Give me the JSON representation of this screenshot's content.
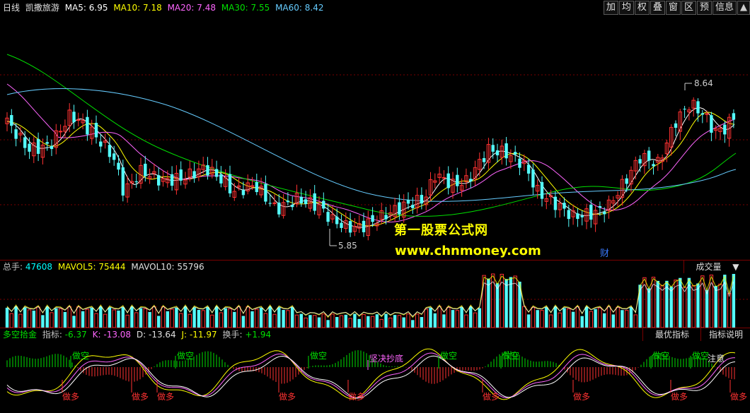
{
  "header": {
    "period": "日线",
    "stock_name": "凯撒旅游",
    "ma5": {
      "label": "MA5:",
      "value": "6.95",
      "color": "#ffffff"
    },
    "ma10": {
      "label": "MA10:",
      "value": "7.18",
      "color": "#ffff00"
    },
    "ma20": {
      "label": "MA20:",
      "value": "7.48",
      "color": "#ff66ff"
    },
    "ma30": {
      "label": "MA30:",
      "value": "7.55",
      "color": "#00e000"
    },
    "ma60": {
      "label": "MA60:",
      "value": "8.42",
      "color": "#66ccff"
    },
    "buttons": [
      "加",
      "均",
      "权",
      "叠",
      "窗",
      "区",
      "预",
      "信息"
    ],
    "expand_arrow": "▲"
  },
  "price_chart": {
    "high_label": "8.64",
    "low_label": "5.85",
    "finance_marker": "财"
  },
  "watermark": {
    "line1": "第一股票公式网",
    "line2": "www.chnmoney.com"
  },
  "volume_panel": {
    "total_label": "总手:",
    "total_value": "47608",
    "mavol5_label": "MAVOL5:",
    "mavol5_value": "75444",
    "mavol10_label": "MAVOL10:",
    "mavol10_value": "55796",
    "selector": "成交量",
    "selector_arrow": "▼"
  },
  "indicator_panel": {
    "name": "多空拾金",
    "index_label": "指标:",
    "index_value": "-6.37",
    "k_label": "K:",
    "k_value": "-13.08",
    "d_label": "D:",
    "d_value": "-13.64",
    "j_label": "J:",
    "j_value": "-11.97",
    "turnover_label": "换手:",
    "turnover_value": "+1.94",
    "best_button": "最优指标",
    "explain_button": "指标说明",
    "signal_short": "做空",
    "signal_long": "做多",
    "signal_bottom": "坚决抄底",
    "signal_attention": "注意"
  },
  "colors": {
    "up": "#ff3232",
    "down": "#54fcfc",
    "grid": "#7a0000",
    "label": "#c0c0c0",
    "vol_label": "#00ffff"
  }
}
